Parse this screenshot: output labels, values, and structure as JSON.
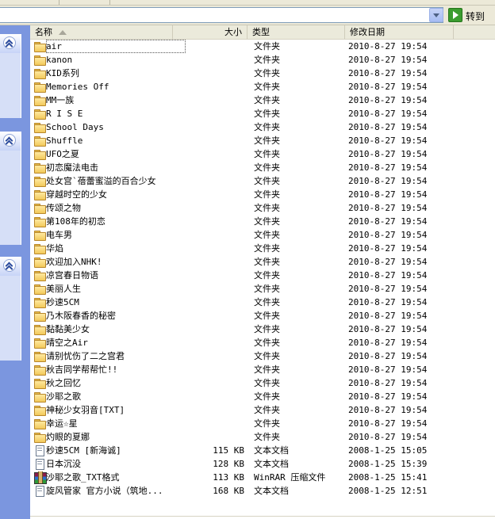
{
  "address": {
    "go_label": "转到"
  },
  "columns": {
    "name": "名称",
    "size": "大小",
    "type": "类型",
    "modified": "修改日期"
  },
  "files": [
    {
      "name": "air",
      "size": "",
      "type": "文件夹",
      "date": "2010-8-27 19:54",
      "icon": "folder-icon"
    },
    {
      "name": "kanon",
      "size": "",
      "type": "文件夹",
      "date": "2010-8-27 19:54",
      "icon": "folder-icon"
    },
    {
      "name": "KID系列",
      "size": "",
      "type": "文件夹",
      "date": "2010-8-27 19:54",
      "icon": "folder-icon"
    },
    {
      "name": "Memories Off",
      "size": "",
      "type": "文件夹",
      "date": "2010-8-27 19:54",
      "icon": "folder-icon"
    },
    {
      "name": "MM一族",
      "size": "",
      "type": "文件夹",
      "date": "2010-8-27 19:54",
      "icon": "folder-icon"
    },
    {
      "name": "R I S E",
      "size": "",
      "type": "文件夹",
      "date": "2010-8-27 19:54",
      "icon": "folder-icon"
    },
    {
      "name": "School Days",
      "size": "",
      "type": "文件夹",
      "date": "2010-8-27 19:54",
      "icon": "folder-icon"
    },
    {
      "name": "Shuffle",
      "size": "",
      "type": "文件夹",
      "date": "2010-8-27 19:54",
      "icon": "folder-icon"
    },
    {
      "name": "UFO之夏",
      "size": "",
      "type": "文件夹",
      "date": "2010-8-27 19:54",
      "icon": "folder-icon"
    },
    {
      "name": "初恋魔法电击",
      "size": "",
      "type": "文件夹",
      "date": "2010-8-27 19:54",
      "icon": "folder-icon"
    },
    {
      "name": "处女宫`蓓蕾蜜溢的百合少女",
      "size": "",
      "type": "文件夹",
      "date": "2010-8-27 19:54",
      "icon": "folder-icon"
    },
    {
      "name": "穿越时空的少女",
      "size": "",
      "type": "文件夹",
      "date": "2010-8-27 19:54",
      "icon": "folder-icon"
    },
    {
      "name": "传颂之物",
      "size": "",
      "type": "文件夹",
      "date": "2010-8-27 19:54",
      "icon": "folder-icon"
    },
    {
      "name": "第108年的初恋",
      "size": "",
      "type": "文件夹",
      "date": "2010-8-27 19:54",
      "icon": "folder-icon"
    },
    {
      "name": "电车男",
      "size": "",
      "type": "文件夹",
      "date": "2010-8-27 19:54",
      "icon": "folder-icon"
    },
    {
      "name": "华焰",
      "size": "",
      "type": "文件夹",
      "date": "2010-8-27 19:54",
      "icon": "folder-icon"
    },
    {
      "name": "欢迎加入NHK!",
      "size": "",
      "type": "文件夹",
      "date": "2010-8-27 19:54",
      "icon": "folder-icon"
    },
    {
      "name": "凉宫春日物语",
      "size": "",
      "type": "文件夹",
      "date": "2010-8-27 19:54",
      "icon": "folder-icon"
    },
    {
      "name": "美丽人生",
      "size": "",
      "type": "文件夹",
      "date": "2010-8-27 19:54",
      "icon": "folder-icon"
    },
    {
      "name": "秒速5CM",
      "size": "",
      "type": "文件夹",
      "date": "2010-8-27 19:54",
      "icon": "folder-icon"
    },
    {
      "name": "乃木阪春香的秘密",
      "size": "",
      "type": "文件夹",
      "date": "2010-8-27 19:54",
      "icon": "folder-icon"
    },
    {
      "name": "黏黏美少女",
      "size": "",
      "type": "文件夹",
      "date": "2010-8-27 19:54",
      "icon": "folder-icon"
    },
    {
      "name": "晴空之Air",
      "size": "",
      "type": "文件夹",
      "date": "2010-8-27 19:54",
      "icon": "folder-icon"
    },
    {
      "name": "请别忧伤了二之宫君",
      "size": "",
      "type": "文件夹",
      "date": "2010-8-27 19:54",
      "icon": "folder-icon"
    },
    {
      "name": "秋吉同学帮帮忙!!",
      "size": "",
      "type": "文件夹",
      "date": "2010-8-27 19:54",
      "icon": "folder-icon"
    },
    {
      "name": "秋之回忆",
      "size": "",
      "type": "文件夹",
      "date": "2010-8-27 19:54",
      "icon": "folder-icon"
    },
    {
      "name": "沙耶之歌",
      "size": "",
      "type": "文件夹",
      "date": "2010-8-27 19:54",
      "icon": "folder-icon"
    },
    {
      "name": "神秘少女羽音[TXT]",
      "size": "",
      "type": "文件夹",
      "date": "2010-8-27 19:54",
      "icon": "folder-icon"
    },
    {
      "name": "幸运☆星",
      "size": "",
      "type": "文件夹",
      "date": "2010-8-27 19:54",
      "icon": "folder-icon"
    },
    {
      "name": "灼眼的夏娜",
      "size": "",
      "type": "文件夹",
      "date": "2010-8-27 19:54",
      "icon": "folder-icon"
    },
    {
      "name": "秒速5CM [新海诚]",
      "size": "115 KB",
      "type": "文本文档",
      "date": "2008-1-25 15:05",
      "icon": "text-document-icon"
    },
    {
      "name": "日本沉没",
      "size": "128 KB",
      "type": "文本文档",
      "date": "2008-1-25 15:39",
      "icon": "text-document-icon"
    },
    {
      "name": "沙耶之歌_TXT格式",
      "size": "113 KB",
      "type": "WinRAR 压缩文件",
      "date": "2008-1-25 15:41",
      "icon": "winrar-archive-icon"
    },
    {
      "name": "旋风管家 官方小说（筑地...",
      "size": "168 KB",
      "type": "文本文档",
      "date": "2008-1-25 12:51",
      "icon": "text-document-icon"
    }
  ]
}
